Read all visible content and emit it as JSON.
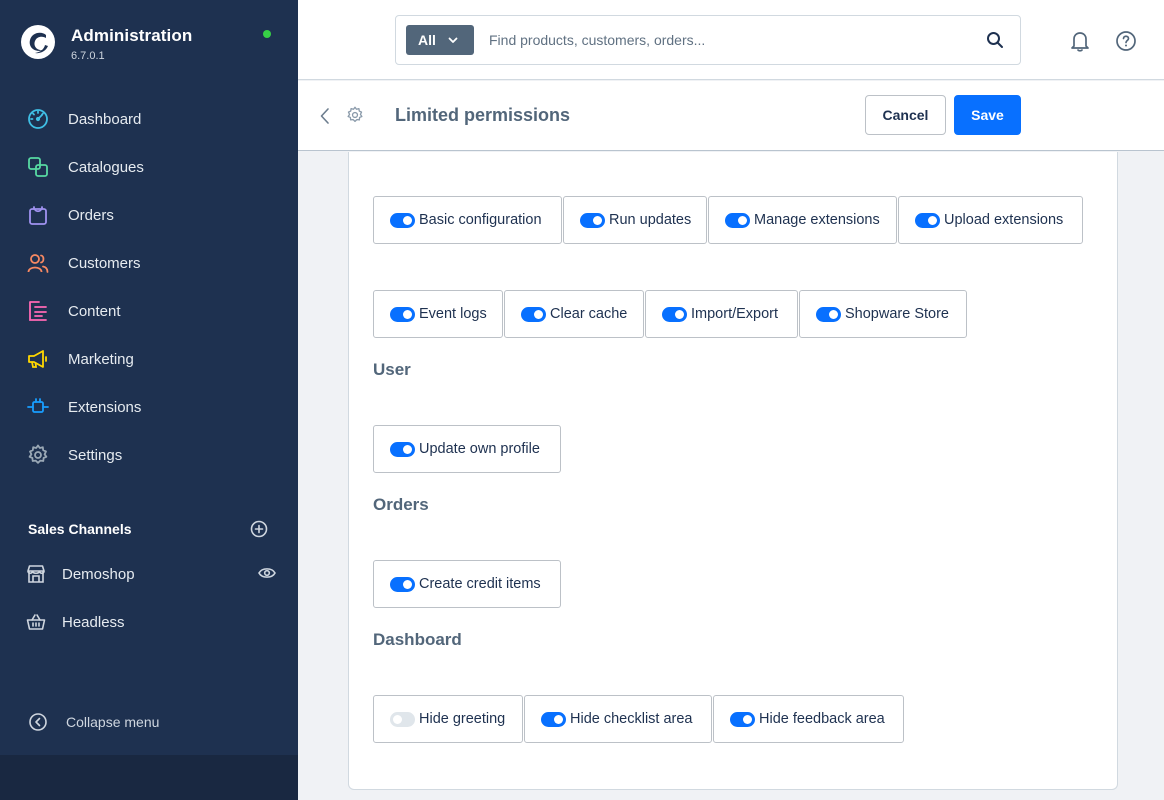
{
  "app": {
    "title": "Administration",
    "version": "6.7.0.1",
    "status_color": "#37d046"
  },
  "sidebar": {
    "items": [
      {
        "label": "Dashboard",
        "icon": "gauge-icon",
        "color": "#3fbfe5"
      },
      {
        "label": "Catalogues",
        "icon": "products-icon",
        "color": "#57d9a3"
      },
      {
        "label": "Orders",
        "icon": "shopping-bag-icon",
        "color": "#a092f0"
      },
      {
        "label": "Customers",
        "icon": "users-icon",
        "color": "#f88962"
      },
      {
        "label": "Content",
        "icon": "content-icon",
        "color": "#ff68b4"
      },
      {
        "label": "Marketing",
        "icon": "megaphone-icon",
        "color": "#ffd700"
      },
      {
        "label": "Extensions",
        "icon": "plugin-icon",
        "color": "#189eff"
      },
      {
        "label": "Settings",
        "icon": "gear-icon",
        "color": "#9aa8b5"
      }
    ],
    "sales_channels": {
      "title": "Sales Channels",
      "items": [
        {
          "label": "Demoshop",
          "icon": "storefront-icon"
        },
        {
          "label": "Headless",
          "icon": "basket-icon"
        }
      ]
    },
    "collapse_label": "Collapse menu"
  },
  "search": {
    "type_label": "All",
    "placeholder": "Find products, customers, orders..."
  },
  "smartbar": {
    "title": "Limited permissions",
    "cancel_label": "Cancel",
    "save_label": "Save"
  },
  "permissions": {
    "system_row1": [
      {
        "label": "Basic configuration",
        "enabled": true
      },
      {
        "label": "Run updates",
        "enabled": true
      },
      {
        "label": "Manage extensions",
        "enabled": true
      },
      {
        "label": "Upload extensions",
        "enabled": true
      }
    ],
    "system_row2": [
      {
        "label": "Event logs",
        "enabled": true
      },
      {
        "label": "Clear cache",
        "enabled": true
      },
      {
        "label": "Import/Export",
        "enabled": true
      },
      {
        "label": "Shopware Store",
        "enabled": true
      }
    ],
    "user": {
      "title": "User",
      "items": [
        {
          "label": "Update own profile",
          "enabled": true
        }
      ]
    },
    "orders": {
      "title": "Orders",
      "items": [
        {
          "label": "Create credit items",
          "enabled": true
        }
      ]
    },
    "dashboard": {
      "title": "Dashboard",
      "items": [
        {
          "label": "Hide greeting",
          "enabled": false
        },
        {
          "label": "Hide checklist area",
          "enabled": true
        },
        {
          "label": "Hide feedback area",
          "enabled": true
        }
      ]
    }
  },
  "colors": {
    "accent": "#0870ff",
    "sidebar_bg": "#1e3150"
  }
}
